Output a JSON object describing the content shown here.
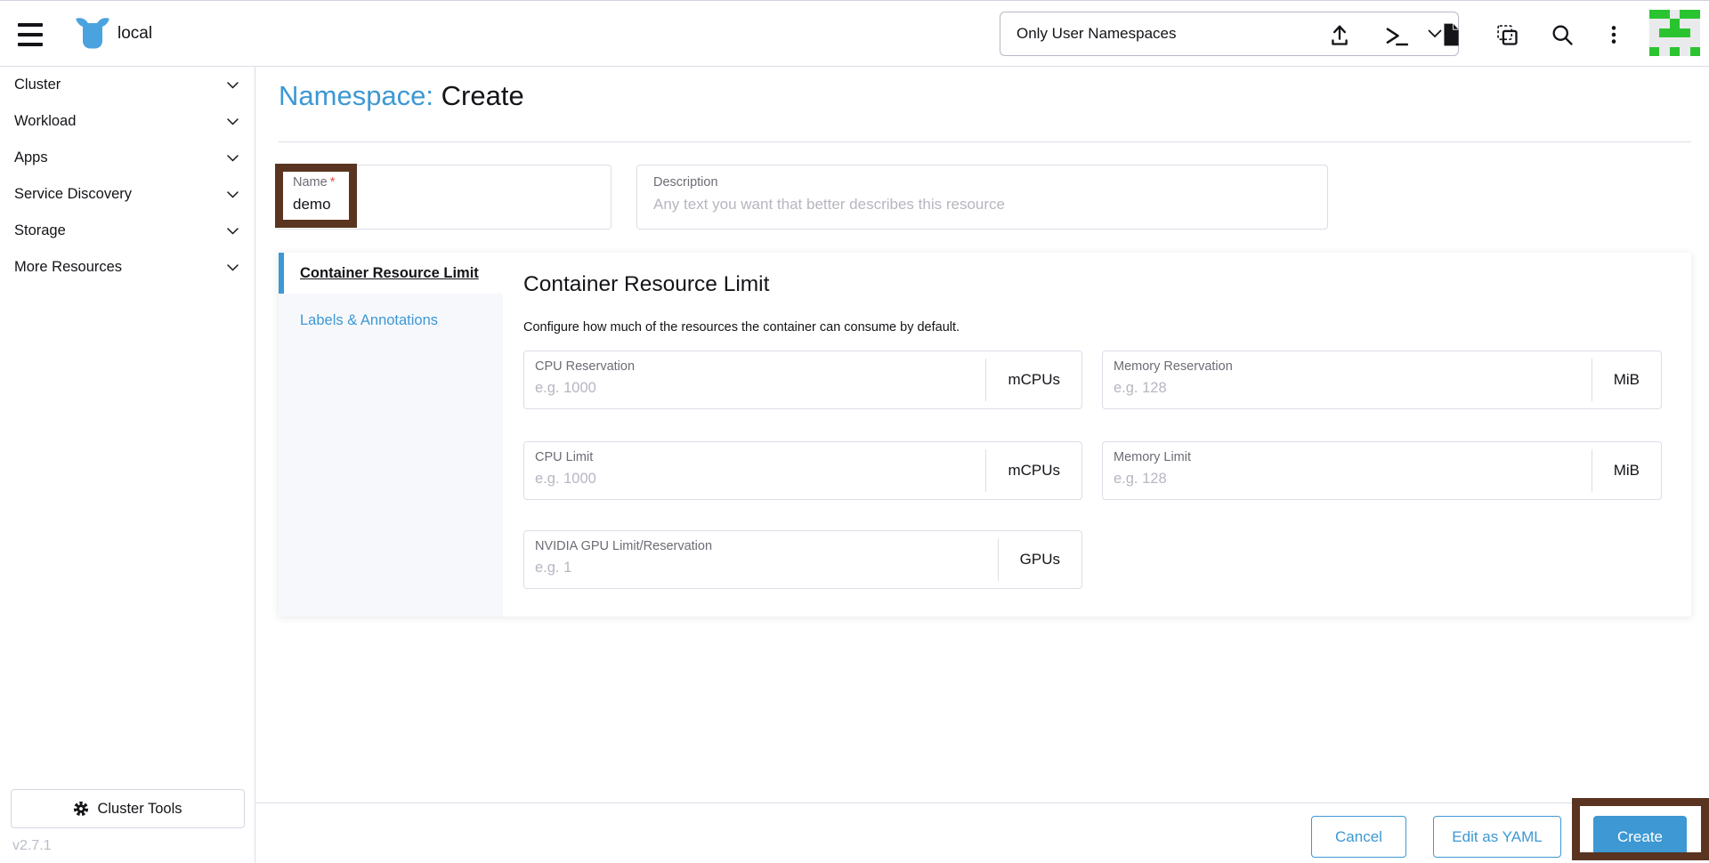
{
  "colors": {
    "accent_blue": "#3d98d3",
    "annotation_brown": "#5a3420",
    "avatar_green": "#2bc431",
    "border_gray": "#dcdee7"
  },
  "header": {
    "cluster_name": "local",
    "namespace_filter": {
      "selected": "Only User Namespaces"
    },
    "icon_names": [
      "hamburger-menu-icon",
      "rancher-logo",
      "import-yaml-icon",
      "kubectl-shell-icon",
      "docs-icon",
      "copy-kubeconfig-icon",
      "search-icon",
      "kebab-menu-icon",
      "user-avatar"
    ]
  },
  "sidebar": {
    "items": [
      {
        "label": "Cluster"
      },
      {
        "label": "Workload"
      },
      {
        "label": "Apps"
      },
      {
        "label": "Service Discovery"
      },
      {
        "label": "Storage"
      },
      {
        "label": "More Resources"
      }
    ],
    "cluster_tools_label": "Cluster Tools",
    "version": "v2.7.1"
  },
  "page": {
    "title_prefix": "Namespace:",
    "title_action": "Create",
    "name_field": {
      "label": "Name",
      "required_marker": "*",
      "value": "demo"
    },
    "description_field": {
      "label": "Description",
      "placeholder": "Any text you want that better describes this resource"
    },
    "tabs": [
      {
        "label": "Container Resource Limit",
        "active": true
      },
      {
        "label": "Labels & Annotations",
        "active": false
      }
    ],
    "panel": {
      "heading": "Container Resource Limit",
      "description": "Configure how much of the resources the container can consume by default.",
      "fields": [
        {
          "label": "CPU Reservation",
          "placeholder": "e.g. 1000",
          "unit": "mCPUs"
        },
        {
          "label": "Memory Reservation",
          "placeholder": "e.g. 128",
          "unit": "MiB"
        },
        {
          "label": "CPU Limit",
          "placeholder": "e.g. 1000",
          "unit": "mCPUs"
        },
        {
          "label": "Memory Limit",
          "placeholder": "e.g. 128",
          "unit": "MiB"
        },
        {
          "label": "NVIDIA GPU Limit/Reservation",
          "placeholder": "e.g. 1",
          "unit": "GPUs"
        }
      ]
    },
    "footer": {
      "cancel_label": "Cancel",
      "edit_yaml_label": "Edit as YAML",
      "create_label": "Create"
    }
  }
}
